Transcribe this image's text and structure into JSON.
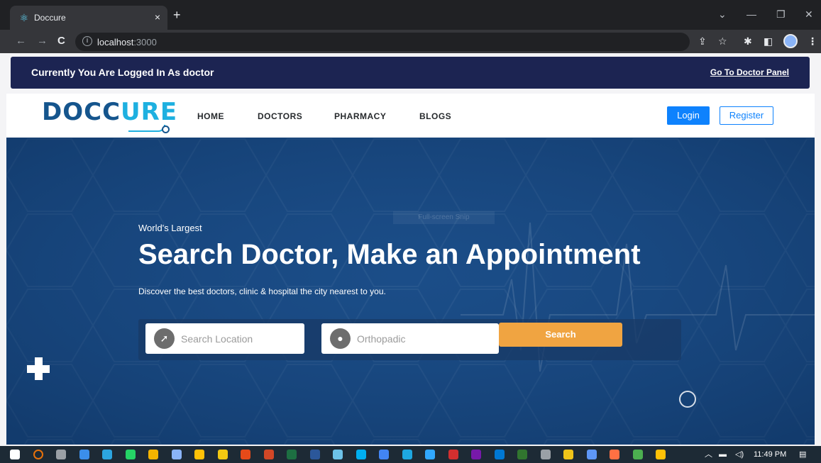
{
  "browser": {
    "tab_title": "Doccure",
    "tab_close": "×",
    "new_tab": "+",
    "favicon": "react-icon",
    "url_host": "localhost",
    "url_port": ":3000",
    "window_controls": {
      "chevron": "⌄",
      "minimize": "—",
      "restore": "❐",
      "close": "✕"
    },
    "nav": {
      "back": "←",
      "forward": "→",
      "reload": "C"
    },
    "toolbar_icons": {
      "share": "⇪",
      "bookmark": "☆",
      "extensions": "✱",
      "sidepanel": "◧",
      "menu": "⋮"
    }
  },
  "notice": {
    "text": "Currently You Are Logged In As doctor",
    "link": "Go To Doctor Panel"
  },
  "header": {
    "logo_part1": "DOCC",
    "logo_part2": "URE",
    "nav": [
      "HOME",
      "DOCTORS",
      "PHARMACY",
      "BLOGS"
    ],
    "login": "Login",
    "register": "Register"
  },
  "hero": {
    "ghost_label": "Full-screen Snip",
    "kicker": "World's Largest",
    "title": "Search Doctor, Make an Appointment",
    "subtitle": "Discover the best doctors, clinic & hospital the city nearest to you.",
    "location_placeholder": "Search Location",
    "specialty_placeholder": "Orthopadic",
    "search_button": "Search"
  },
  "taskbar": {
    "time": "11:49 PM",
    "app_colors": [
      "#ffffff",
      "#e8710a",
      "#9aa0a6",
      "#3b8eea",
      "#2ca5e0",
      "#25d366",
      "#f4b400",
      "#8ab4f8",
      "#ffc107",
      "#f2c811",
      "#e64a19",
      "#d24726",
      "#1d6f42",
      "#2b579a",
      "#6dc2e8",
      "#00aff0",
      "#4285f4",
      "#1ea7e1",
      "#31a8ff",
      "#d32f2f",
      "#7719aa",
      "#0078d4",
      "#31752f",
      "#9aa0a6",
      "#f0c419",
      "#5e97f6",
      "#ff7043",
      "#4caf50",
      "#ffc107"
    ]
  },
  "colors": {
    "notice_bg": "#1c2452",
    "hero_bg": "#1a4a82",
    "accent_blue": "#0e82fd",
    "search_orange": "#f0a441"
  }
}
